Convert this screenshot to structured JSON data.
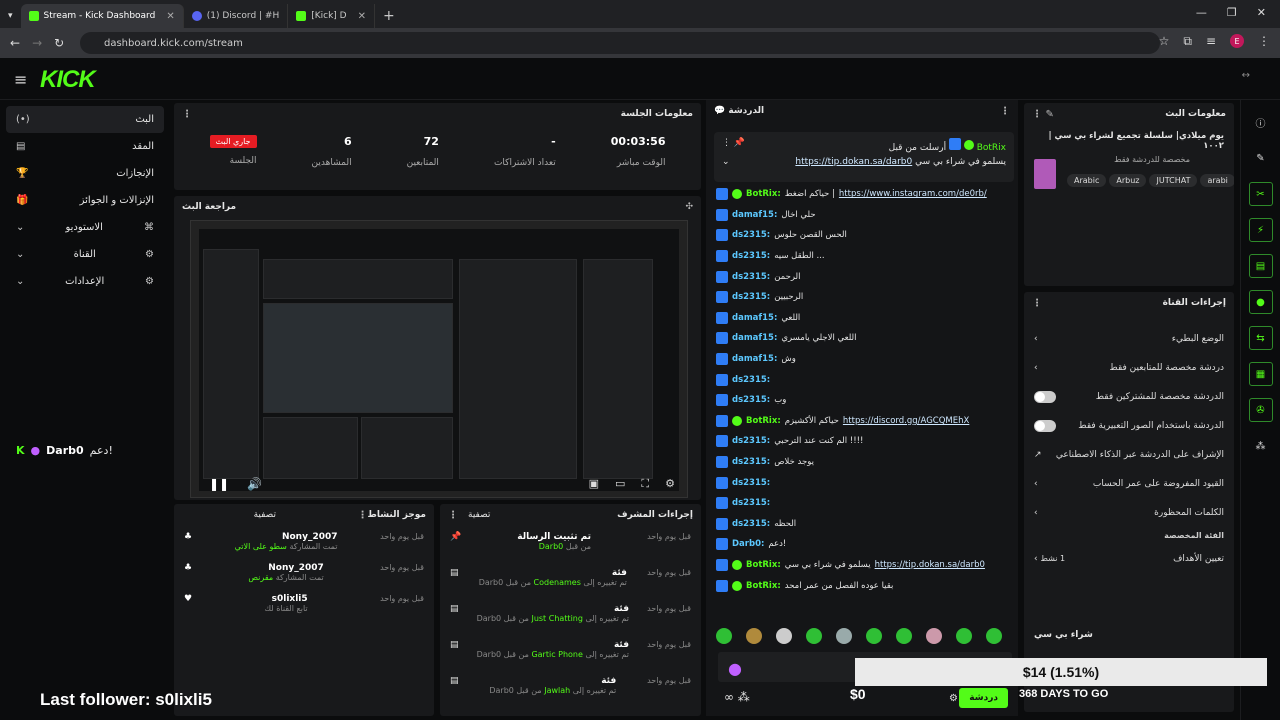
{
  "browser": {
    "tabs": [
      {
        "label": "Stream - Kick Dashboard",
        "active": true
      },
      {
        "label": "(1) Discord | #​H",
        "active": false
      },
      {
        "label": "[Kick] D",
        "active": false
      }
    ],
    "url": "dashboard.kick.com/stream",
    "profile_initial": "E"
  },
  "logo": "KICK",
  "sidebar": {
    "items": [
      {
        "label": "البث",
        "icon": "(•)"
      },
      {
        "label": "المقد",
        "icon": "▤"
      },
      {
        "label": "الإنجازات",
        "icon": "🏆"
      },
      {
        "label": "الإنزالات و الجوائز",
        "icon": "🎁"
      },
      {
        "label": "الاستوديو",
        "icon": "⌘"
      },
      {
        "label": "القناة",
        "icon": "⚙"
      },
      {
        "label": "الإعدادات",
        "icon": "⚙"
      }
    ],
    "follower_label": "دعم!",
    "follower_name": "Darb0"
  },
  "session": {
    "title": "معلومات الجلسة",
    "stats": [
      {
        "value": "00:03:56",
        "label": "الوقت مباشر"
      },
      {
        "value": "-",
        "label": "تعداد الاشتراكات"
      },
      {
        "value": "72",
        "label": "المتابعين"
      },
      {
        "value": "6",
        "label": "المشاهدين"
      },
      {
        "value": "جاري البث",
        "label": "الجلسة"
      }
    ]
  },
  "preview": {
    "title": "مراجعة البث"
  },
  "activity": {
    "title": "موجز النشاط",
    "filter": "تصفية",
    "items": [
      {
        "name": "Nony_2007",
        "sub": "تمت المشاركة",
        "tier": "سطو على الاتي",
        "time": "قبل يوم واحد",
        "icon": "gift"
      },
      {
        "name": "Nony_2007",
        "sub": "تمت المشاركة",
        "tier": "مقرنص",
        "time": "قبل يوم واحد",
        "icon": "gift"
      },
      {
        "name": "s0lixli5",
        "sub": "تابع القناة لك",
        "tier": "",
        "time": "قبل يوم واحد",
        "icon": "heart"
      }
    ]
  },
  "mod_actions": {
    "title": "إجراءات المشرف",
    "filter": "تصفية",
    "items": [
      {
        "title": "تم تثبيت الرسالة",
        "sub": "من قبل",
        "who": "Darb0",
        "time": "قبل يوم واحد"
      },
      {
        "title": "فئة",
        "sub": "تم تغييره إلى",
        "who": "Codenames",
        "by": "من قبل Darb0",
        "time": "قبل يوم واحد"
      },
      {
        "title": "فئة",
        "sub": "تم تغييره إلى",
        "who": "Just Chatting",
        "by": "من قبل Darb0",
        "time": "قبل يوم واحد"
      },
      {
        "title": "فئة",
        "sub": "تم تغييره إلى",
        "who": "Gartic Phone",
        "by": "من قبل Darb0",
        "time": "قبل يوم واحد"
      },
      {
        "title": "فئة",
        "sub": "تم تغييره إلى",
        "who": "Jawlah",
        "by": "من قبل Darb0",
        "time": "قبل يوم واحد"
      }
    ]
  },
  "chat": {
    "title": "الدردشة",
    "pinned": {
      "label": "أرسلت من قبل",
      "user": "BotRix",
      "text": "يسلمو في شراء بي سي",
      "link": "https://tip.dokan.sa/darb0"
    },
    "lines": [
      {
        "user": "BotRix:",
        "text": "حياكم اضغط | ",
        "link": "https://www.instagram.com/de0rb/",
        "bot": true
      },
      {
        "user": "damaf15:",
        "text": "حلي اخال",
        "bot": false
      },
      {
        "user": "ds2315:",
        "text": "الحس القصن حلوس",
        "bot": false
      },
      {
        "user": "ds2315:",
        "text": "الطقل سيه ...",
        "bot": false
      },
      {
        "user": "ds2315:",
        "text": "الرحمن",
        "bot": false
      },
      {
        "user": "ds2315:",
        "text": "الرحبيين",
        "bot": false
      },
      {
        "user": "damaf15:",
        "text": "اللعي",
        "bot": false
      },
      {
        "user": "damaf15:",
        "text": "اللعي الاجلي يامسري",
        "bot": false
      },
      {
        "user": "damaf15:",
        "text": "وش",
        "bot": false
      },
      {
        "user": "ds2315:",
        "text": "",
        "bot": false
      },
      {
        "user": "ds2315:",
        "text": "وب",
        "bot": false
      },
      {
        "user": "BotRix:",
        "text": "حياكم الأكشيزم ",
        "link": "https://discord.gg/AGCQMEhX",
        "bot": true
      },
      {
        "user": "ds2315:",
        "text": "الم كنت عند الترحبي !!!!",
        "bot": false
      },
      {
        "user": "ds2315:",
        "text": "يوجد خلاص",
        "bot": false
      },
      {
        "user": "ds2315:",
        "text": "",
        "bot": false
      },
      {
        "user": "ds2315:",
        "text": "",
        "bot": false
      },
      {
        "user": "ds2315:",
        "text": "الحظه",
        "bot": false
      },
      {
        "user": "Darb0:",
        "text": "دعم!",
        "bot": false
      },
      {
        "user": "BotRix:",
        "text": "يسلمو في شراء بي سي ",
        "link": "https://tip.dokan.sa/darb0",
        "bot": true
      },
      {
        "user": "BotRix:",
        "text": "بقيا عوده الفصل من عمر امحد",
        "bot": true
      }
    ],
    "send_label": "دردشة"
  },
  "stream_info": {
    "title": "معلومات البث",
    "stream_title": "يوم ميلادي| سلسلة تجميع لشراء بي سي | ١٠٠٢",
    "sub": "مخصصة للدردشة فقط",
    "tags": [
      "Arabic",
      "Arbuz",
      "JUTCHAT",
      "arabi"
    ]
  },
  "channel_actions": {
    "title": "إجراءات القناة",
    "items": [
      {
        "label": "الوضع البطيء",
        "control": "chevron"
      },
      {
        "label": "دردشة مخصصة للمتابعين فقط",
        "control": "chevron"
      },
      {
        "label": "الدردشة مخصصة للمشتركين فقط",
        "control": "toggle"
      },
      {
        "label": "الدردشة باستخدام الصور التعبيرية فقط",
        "control": "toggle"
      },
      {
        "label": "الإشراف على الدردشة عبر الذكاء الاصطناعي",
        "control": "link"
      },
      {
        "label": "القيود المفروضة على عمر الحساب",
        "control": "chevron"
      },
      {
        "label": "الكلمات المحظورة",
        "control": "chevron"
      }
    ],
    "custom_title": "الفئة المخصصة",
    "goals_label": "تعيين الأهداف",
    "goals_count": "1 نشط"
  },
  "overlay": {
    "last_follower": "Last follower: s0lixli5",
    "goal_text": "$14 (1.51%)",
    "goal_amount": "$0",
    "goal_days": "368 DAYS TO GO",
    "goal_title": "شراء بي سي"
  }
}
